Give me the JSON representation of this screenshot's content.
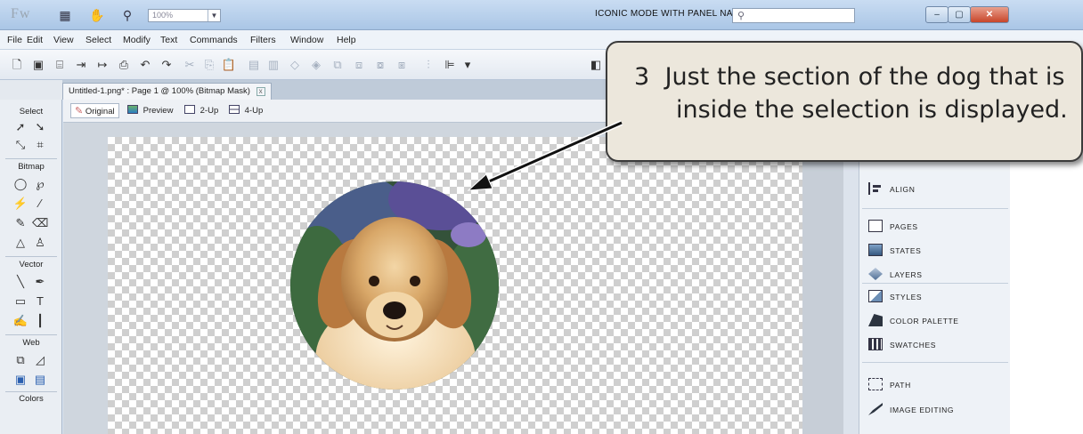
{
  "titlebar": {
    "logo": "Fw",
    "zoom_value": "100%",
    "workspace_label": "ICONIC MODE WITH PANEL NAMES",
    "search_placeholder": ""
  },
  "menu": [
    "File",
    "Edit",
    "View",
    "Select",
    "Modify",
    "Text",
    "Commands",
    "Filters",
    "Window",
    "Help"
  ],
  "document_tab": {
    "title": "Untitled-1.png* : Page 1 @ 100% (Bitmap Mask)",
    "close_label": "x"
  },
  "view_tabs": [
    {
      "label": "Original",
      "active": true
    },
    {
      "label": "Preview",
      "active": false
    },
    {
      "label": "2-Up",
      "active": false
    },
    {
      "label": "4-Up",
      "active": false
    }
  ],
  "tools_panel": {
    "sections": [
      "Select",
      "Bitmap",
      "Vector",
      "Web",
      "Colors"
    ]
  },
  "right_panel": {
    "items": [
      "ALIGN",
      "PAGES",
      "STATES",
      "LAYERS",
      "STYLES",
      "COLOR PALETTE",
      "SWATCHES",
      "PATH",
      "IMAGE EDITING"
    ]
  },
  "callout": {
    "number": "3",
    "line1": "Just the section of the dog that is",
    "line2": "inside the selection is displayed."
  },
  "colors": {
    "callout_bg": "#ece7dc",
    "titlebar": "#aac6e6",
    "close_button": "#c8452a"
  }
}
